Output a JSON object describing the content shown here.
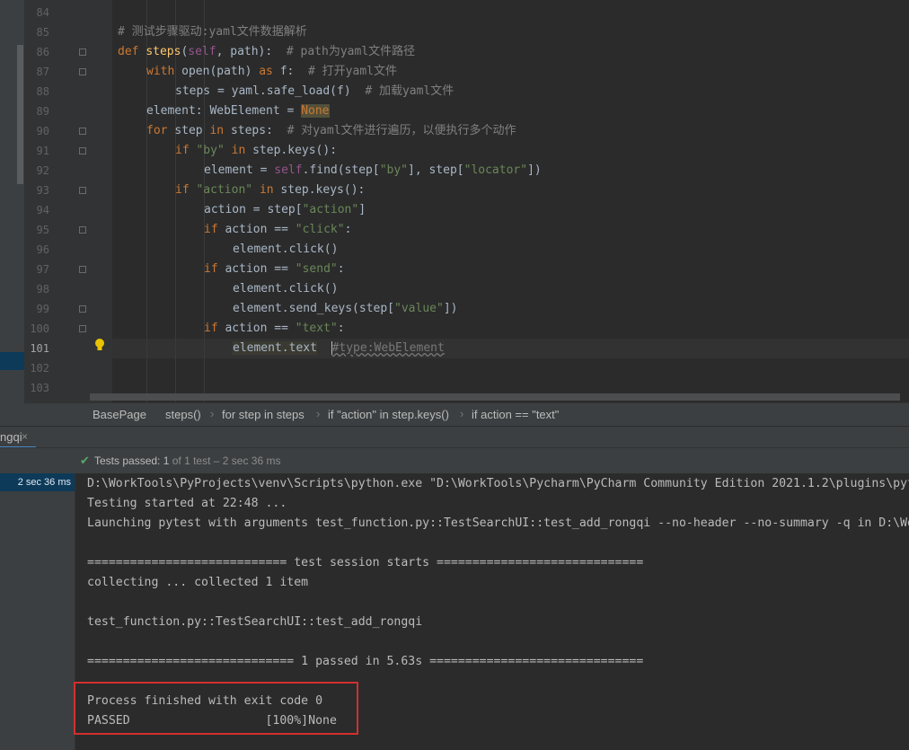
{
  "editor": {
    "lines": [
      {
        "n": "84",
        "cur": false
      },
      {
        "n": "85",
        "cur": false
      },
      {
        "n": "86",
        "cur": false
      },
      {
        "n": "87",
        "cur": false
      },
      {
        "n": "88",
        "cur": false
      },
      {
        "n": "89",
        "cur": false
      },
      {
        "n": "90",
        "cur": false
      },
      {
        "n": "91",
        "cur": false
      },
      {
        "n": "92",
        "cur": false
      },
      {
        "n": "93",
        "cur": false
      },
      {
        "n": "94",
        "cur": false
      },
      {
        "n": "95",
        "cur": false
      },
      {
        "n": "96",
        "cur": false
      },
      {
        "n": "97",
        "cur": false
      },
      {
        "n": "98",
        "cur": false
      },
      {
        "n": "99",
        "cur": false
      },
      {
        "n": "100",
        "cur": false
      },
      {
        "n": "101",
        "cur": true
      },
      {
        "n": "102",
        "cur": false
      },
      {
        "n": "103",
        "cur": false
      }
    ],
    "code": {
      "l85": "# 测试步骤驱动:yaml文件数据解析",
      "l86_def": "def ",
      "l86_fn": "steps",
      "l86_p1": "(",
      "l86_self": "self",
      "l86_p2": ", path):  ",
      "l86_cm": "# path为yaml文件路径",
      "l87_with": "with ",
      "l87_open": "open(path) ",
      "l87_as": "as ",
      "l87_f": "f:  ",
      "l87_cm": "# 打开yaml文件",
      "l88_a": "steps = yaml.safe_load(f)  ",
      "l88_cm": "# 加载yaml文件",
      "l89_a": "element: WebElement = ",
      "l89_none": "None",
      "l90_for": "for ",
      "l90_a": "step ",
      "l90_in": "in ",
      "l90_b": "steps:  ",
      "l90_cm": "# 对yaml文件进行遍历，以便执行多个动作",
      "l91_if": "if ",
      "l91_s": "\"by\" ",
      "l91_in": "in ",
      "l91_b": "step.keys():",
      "l92_a": "element = ",
      "l92_self": "self",
      "l92_b": ".find(step[",
      "l92_s1": "\"by\"",
      "l92_c": "], step[",
      "l92_s2": "\"locator\"",
      "l92_d": "])",
      "l93_if": "if ",
      "l93_s": "\"action\" ",
      "l93_in": "in ",
      "l93_b": "step.keys():",
      "l94_a": "action = step[",
      "l94_s": "\"action\"",
      "l94_b": "]",
      "l95_if": "if ",
      "l95_a": "action == ",
      "l95_s": "\"click\"",
      "l95_b": ":",
      "l96": "element.click()",
      "l97_if": "if ",
      "l97_a": "action == ",
      "l97_s": "\"send\"",
      "l97_b": ":",
      "l98": "element.click()",
      "l99_a": "element.send_keys(step[",
      "l99_s": "\"value\"",
      "l99_b": "])",
      "l100_if": "if ",
      "l100_a": "action == ",
      "l100_s": "\"text\"",
      "l100_b": ":",
      "l101_a": "element.text",
      "l101_hint": "#type:WebElement"
    }
  },
  "breadcrumb": [
    "BasePage",
    "steps()",
    "for step in steps",
    "if \"action\" in step.keys()",
    "if action == \"text\""
  ],
  "run_tab": {
    "label": "ngqi",
    "close": "×"
  },
  "status": {
    "prefix": "Tests passed: ",
    "passed": "1",
    "rest": " of 1 test – 2 sec 36 ms"
  },
  "tree": {
    "selected_time": "2 sec 36 ms"
  },
  "console": {
    "lines": [
      "D:\\WorkTools\\PyProjects\\venv\\Scripts\\python.exe \"D:\\WorkTools\\Pycharm\\PyCharm Community Edition 2021.1.2\\plugins\\python-ce\\helpers\\pycharm\\_jb_pytest_runner.py\"",
      "Testing started at 22:48 ...",
      "Launching pytest with arguments test_function.py::TestSearchUI::test_add_rongqi --no-header --no-summary -q in D:\\WorkTools\\PyProjects",
      "",
      "============================ test session starts =============================",
      "collecting ... collected 1 item",
      "",
      "test_function.py::TestSearchUI::test_add_rongqi",
      "",
      "============================= 1 passed in 5.63s ==============================",
      "",
      "Process finished with exit code 0",
      "PASSED                   [100%]None"
    ]
  },
  "icons": {
    "bulb": "lightbulb-icon",
    "check": "check-icon",
    "close": "close-icon"
  }
}
